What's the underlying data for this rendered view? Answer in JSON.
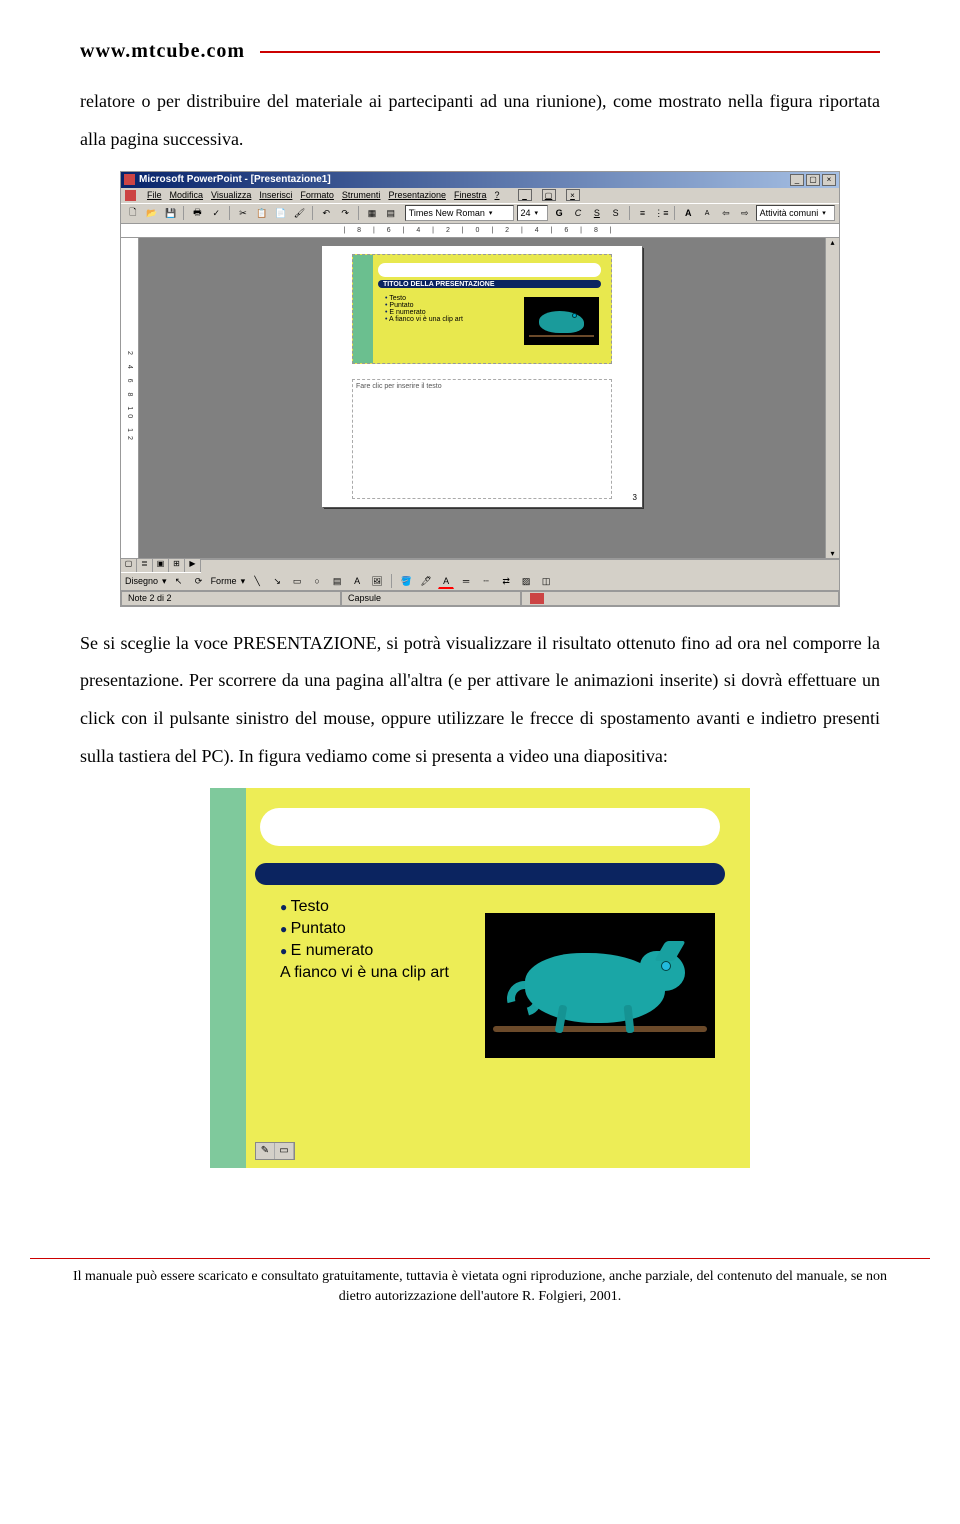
{
  "header": {
    "url": "www.mtcube.com"
  },
  "para1": "relatore o per distribuire del materiale ai partecipanti ad una riunione), come mostrato nella figura riportata alla pagina successiva.",
  "para2": "Se si sceglie la voce PRESENTAZIONE, si potrà visualizzare il risultato ottenuto fino ad ora nel comporre la presentazione. Per scorrere da una pagina all'altra (e per attivare le animazioni inserite) si dovrà effettuare un click con il pulsante sinistro del mouse, oppure utilizzare le frecce di spostamento avanti e indietro presenti sulla tastiera del PC). In figura vediamo come si presenta a video una diapositiva:",
  "ppt": {
    "title": "Microsoft PowerPoint - [Presentazione1]",
    "menus": [
      "File",
      "Modifica",
      "Visualizza",
      "Inserisci",
      "Formato",
      "Strumenti",
      "Presentazione",
      "Finestra",
      "?"
    ],
    "font": "Times New Roman",
    "fontsize": "24",
    "formatBtns": [
      "G",
      "C",
      "S",
      "S"
    ],
    "common": "Attività comuni",
    "rulerH": "| 8 | 6 | 4 | 2 | 0 | 2 | 4 | 6 | 8 |",
    "rulerV": "2 4 6 8 10 12",
    "slideTitle": "TITOLO DELLA PRESENTAZIONE",
    "bullets": [
      "Testo",
      "Puntato",
      "E numerato"
    ],
    "extraLine": "A fianco vi è una clip art",
    "notesPlaceholder": "Fare clic per inserire il testo",
    "pageNum": "3",
    "drawLabel": "Disegno",
    "formeLabel": "Forme",
    "statusNote": "Note 2 di 2",
    "statusLayout": "Capsule"
  },
  "bigSlide": {
    "bullets": [
      "Testo",
      "Puntato",
      "E numerato"
    ],
    "extraLine": "A fianco vi è una clip art"
  },
  "footer": "Il manuale può essere scaricato e consultato gratuitamente, tuttavia è vietata ogni riproduzione, anche parziale, del contenuto del manuale, se non dietro autorizzazione dell'autore R. Folgieri, 2001."
}
